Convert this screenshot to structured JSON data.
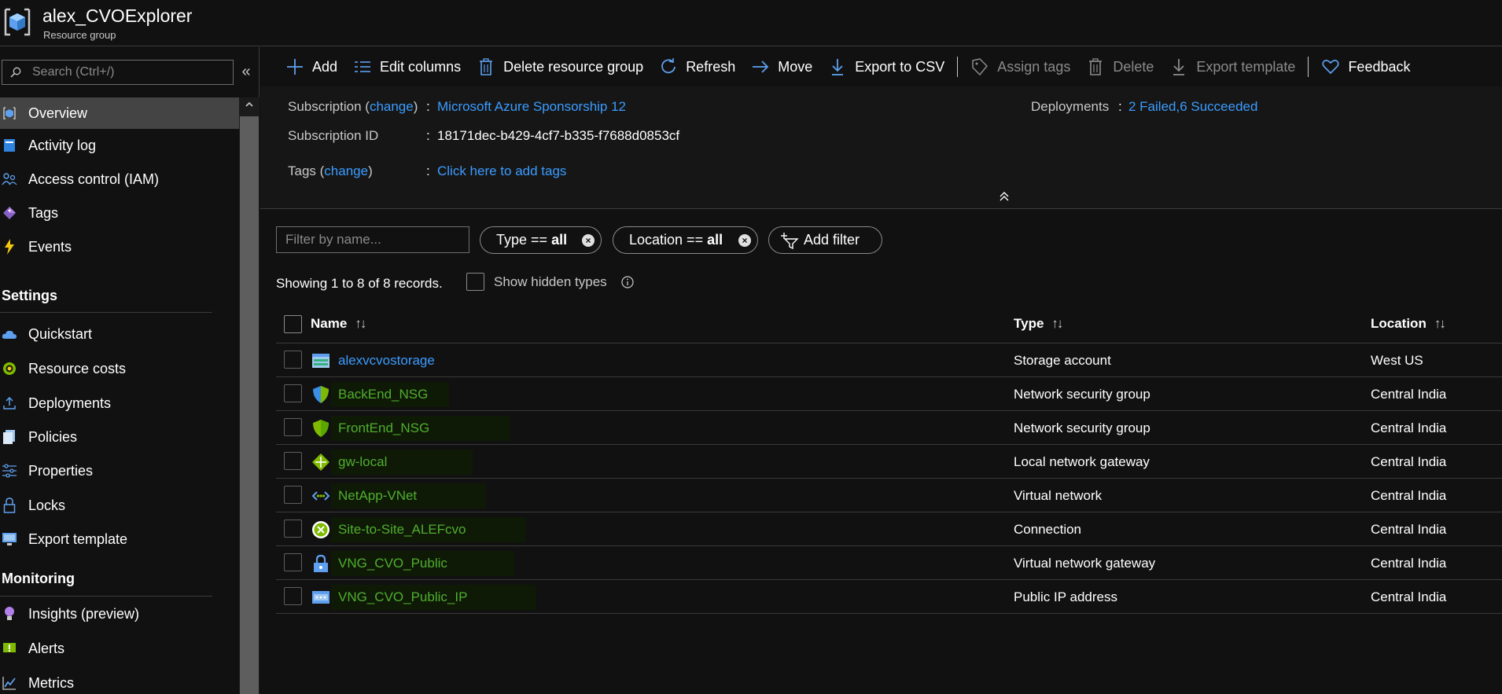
{
  "header": {
    "title": "alex_CVOExplorer",
    "subtitle": "Resource group"
  },
  "sidebar": {
    "search_placeholder": "Search (Ctrl+/)",
    "collapse_glyph": "«",
    "items": [
      {
        "label": "Overview",
        "icon": "cube-icon"
      },
      {
        "label": "Activity log",
        "icon": "log-icon"
      },
      {
        "label": "Access control (IAM)",
        "icon": "people-icon"
      },
      {
        "label": "Tags",
        "icon": "tag-icon"
      },
      {
        "label": "Events",
        "icon": "bolt-icon"
      }
    ],
    "sections": [
      {
        "title": "Settings",
        "items": [
          {
            "label": "Quickstart",
            "icon": "cloud-icon"
          },
          {
            "label": "Resource costs",
            "icon": "coin-icon"
          },
          {
            "label": "Deployments",
            "icon": "upload-icon"
          },
          {
            "label": "Policies",
            "icon": "document-icon"
          },
          {
            "label": "Properties",
            "icon": "sliders-icon"
          },
          {
            "label": "Locks",
            "icon": "lock-icon"
          },
          {
            "label": "Export template",
            "icon": "monitor-icon"
          }
        ]
      },
      {
        "title": "Monitoring",
        "items": [
          {
            "label": "Insights (preview)",
            "icon": "lightbulb-icon"
          },
          {
            "label": "Alerts",
            "icon": "alert-icon"
          },
          {
            "label": "Metrics",
            "icon": "chart-icon"
          }
        ]
      }
    ]
  },
  "toolbar": {
    "add": "Add",
    "edit_columns": "Edit columns",
    "delete_rg": "Delete resource group",
    "refresh": "Refresh",
    "move": "Move",
    "export_csv": "Export to CSV",
    "assign_tags": "Assign tags",
    "delete": "Delete",
    "export_template": "Export template",
    "feedback": "Feedback"
  },
  "essentials": {
    "subscription_label_pre": "Subscription (",
    "subscription_change": "change",
    "subscription_label_post": ")",
    "subscription_value": "Microsoft Azure Sponsorship 12",
    "subscription_id_label": "Subscription ID",
    "subscription_id_value": "18171dec-b429-4cf7-b335-f7688d0853cf",
    "tags_label_pre": "Tags (",
    "tags_change": "change",
    "tags_label_post": ")",
    "tags_value": "Click here to add tags",
    "deployments_label": "Deployments",
    "deployments_value": "2 Failed,6 Succeeded",
    "colon": ":"
  },
  "filters": {
    "name_placeholder": "Filter by name...",
    "type_pill_label": "Type ==",
    "type_pill_value": "all",
    "location_pill_label": "Location ==",
    "location_pill_value": "all",
    "add_filter": "Add filter"
  },
  "records_text": "Showing 1 to 8 of 8 records.",
  "show_hidden_label": "Show hidden types",
  "table": {
    "columns": {
      "name": "Name",
      "type": "Type",
      "location": "Location"
    },
    "sort_glyph": "↑↓",
    "rows": [
      {
        "name": "alexvcvostorage",
        "type": "Storage account",
        "location": "West US",
        "icon": "storage-icon",
        "name_color": "blue"
      },
      {
        "name": "BackEnd_NSG",
        "type": "Network security group",
        "location": "Central India",
        "icon": "shield-icon",
        "name_color": "green"
      },
      {
        "name": "FrontEnd_NSG",
        "type": "Network security group",
        "location": "Central India",
        "icon": "shield-icon",
        "name_color": "green"
      },
      {
        "name": "gw-local",
        "type": "Local network gateway",
        "location": "Central India",
        "icon": "gateway-icon",
        "name_color": "green"
      },
      {
        "name": "NetApp-VNet",
        "type": "Virtual network",
        "location": "Central India",
        "icon": "vnet-icon",
        "name_color": "green"
      },
      {
        "name": "Site-to-Site_ALEFcvo",
        "type": "Connection",
        "location": "Central India",
        "icon": "connection-icon",
        "name_color": "green"
      },
      {
        "name": "VNG_CVO_Public",
        "type": "Virtual network gateway",
        "location": "Central India",
        "icon": "lock-gateway-icon",
        "name_color": "green"
      },
      {
        "name": "VNG_CVO_Public_IP",
        "type": "Public IP address",
        "location": "Central India",
        "icon": "public-ip-icon",
        "name_color": "green"
      }
    ]
  },
  "colors": {
    "link": "#3b9cff",
    "resource_name_green": "#4fae2f",
    "active_nav": "#444444"
  }
}
